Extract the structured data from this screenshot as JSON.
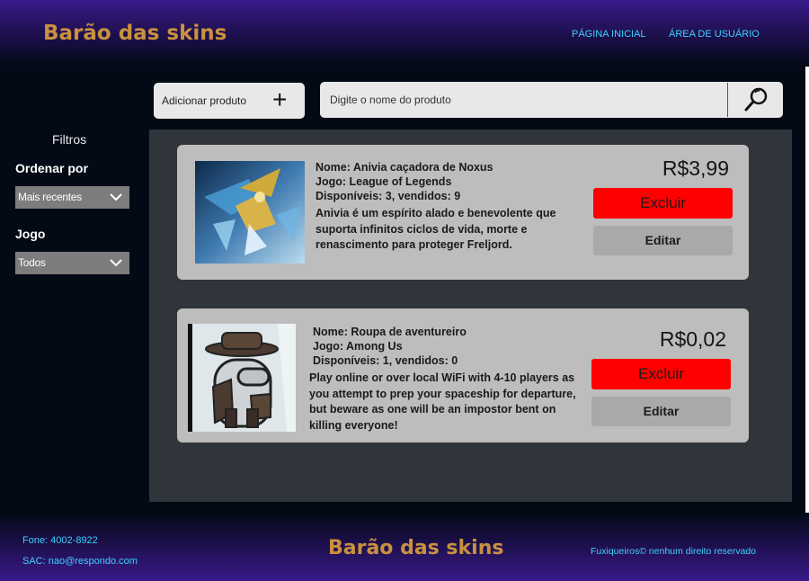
{
  "header": {
    "brand": "Barão das skins",
    "nav": [
      "PÁGINA INICIAL",
      "ÁREA DE USUÁRIO"
    ]
  },
  "toolbar": {
    "add_label": "Adicionar produto",
    "add_icon": "+",
    "search_placeholder": "Digite o nome do produto"
  },
  "sidebar": {
    "title": "Filtros",
    "sort_label": "Ordenar por",
    "sort_value": "Mais recentes",
    "game_label": "Jogo",
    "game_value": "Todos"
  },
  "products": [
    {
      "name": "Nome: Anivia caçadora de Noxus",
      "game": "Jogo: League of Legends",
      "stock": "Disponíveis: 3, vendidos: 9",
      "description": "Anivia é um espírito alado e benevolente que suporta infinitos ciclos de vida, morte e renascimento para proteger Freljord.",
      "price": "R$3,99",
      "delete_label": "Excluir",
      "edit_label": "Editar"
    },
    {
      "name": "Nome:  Roupa de aventureiro",
      "game": "Jogo: Among Us",
      "stock": "Disponíveis: 1, vendidos: 0",
      "description": "Play online or over local WiFi with 4-10 players as you attempt to prep your spaceship for departure, but beware as one will be an impostor bent on killing everyone!",
      "price": "R$0,02",
      "delete_label": "Excluir",
      "edit_label": "Editar"
    }
  ],
  "footer": {
    "phone": "Fone: 4002-8922",
    "sac": "SAC: nao@respondo.com",
    "brand": "Barão das skins",
    "copyright": "Fuxiqueiros© nenhum direito reservado"
  },
  "colors": {
    "brand": "#c9913f",
    "nav_link": "#3fd0ff",
    "delete": "#ff0000",
    "edit": "#a9a9a9",
    "card": "#bdbdbd"
  }
}
